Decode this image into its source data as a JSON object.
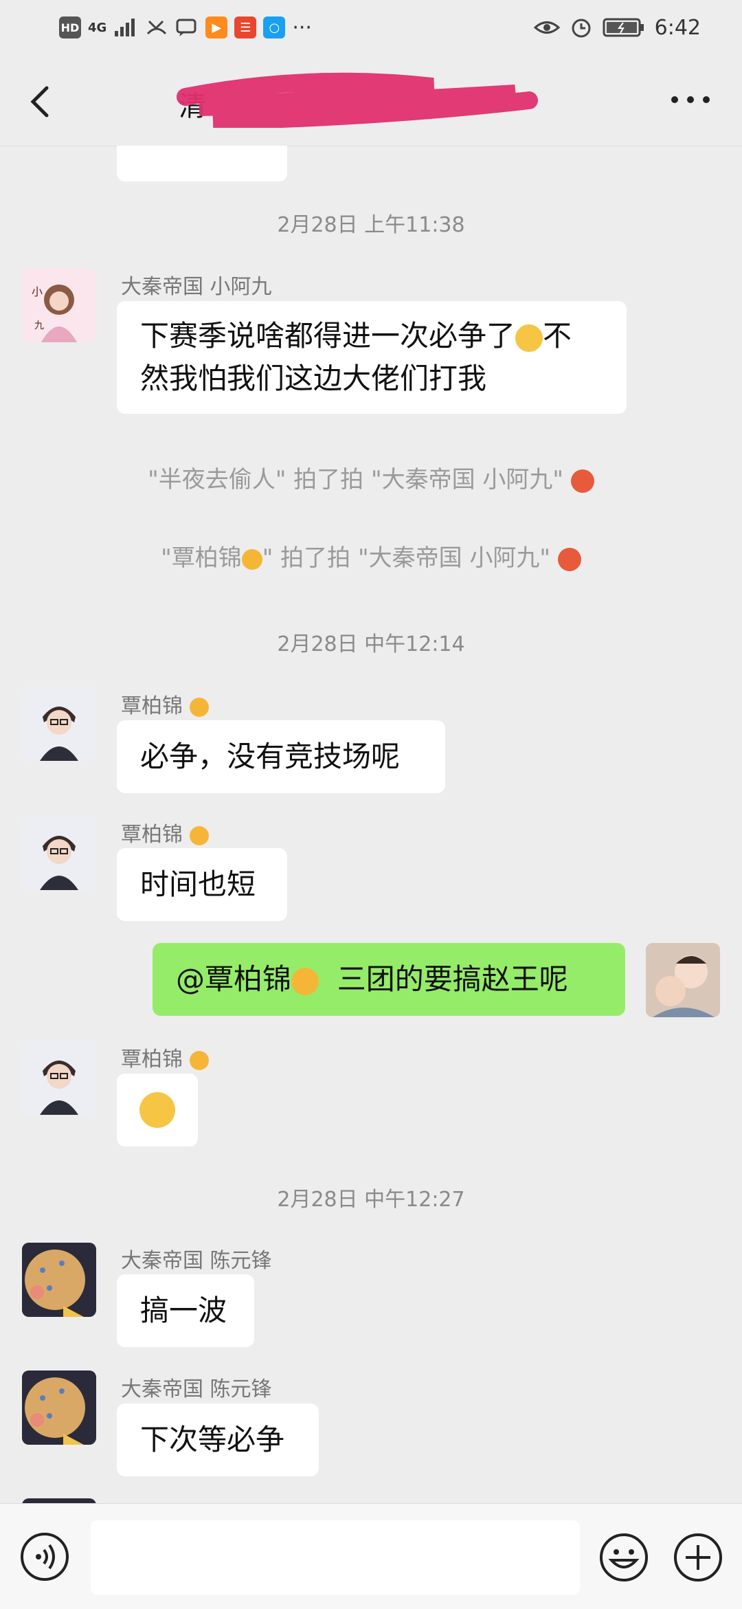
{
  "status": {
    "time": "6:42",
    "left_icons": [
      "HD",
      "4G"
    ]
  },
  "header": {
    "title": "清",
    "more_label": "···"
  },
  "messages": {
    "ts1": "2月28日 上午11:38",
    "m1_sender": "大秦帝国 小阿九",
    "m1_line1": "下赛季说啥都得进一次必争了",
    "m1_line1b": "不",
    "m1_line2": "然我怕我们这边大佬们打我",
    "sys1": "\"半夜去偷人\" 拍了拍 \"大秦帝国 小阿九\"",
    "sys2a": "\"覃柏锦",
    "sys2b": "\" 拍了拍 \"大秦帝国 小阿九\"",
    "ts2": "2月28日 中午12:14",
    "m2_sender": "覃柏锦",
    "m2_text": "必争，没有竞技场呢",
    "m3_sender": "覃柏锦",
    "m3_text": "时间也短",
    "m4_a": "@覃柏锦",
    "m4_b": "三团的要搞赵王呢",
    "m5_sender": "覃柏锦",
    "ts3": "2月28日 中午12:27",
    "m6_sender": "大秦帝国 陈元锋",
    "m6_text": "搞一波",
    "m7_sender": "大秦帝国 陈元锋",
    "m7_text": "下次等必争"
  },
  "colors": {
    "outgoing": "#95ec69",
    "incoming": "#ffffff",
    "background": "#ededed"
  }
}
